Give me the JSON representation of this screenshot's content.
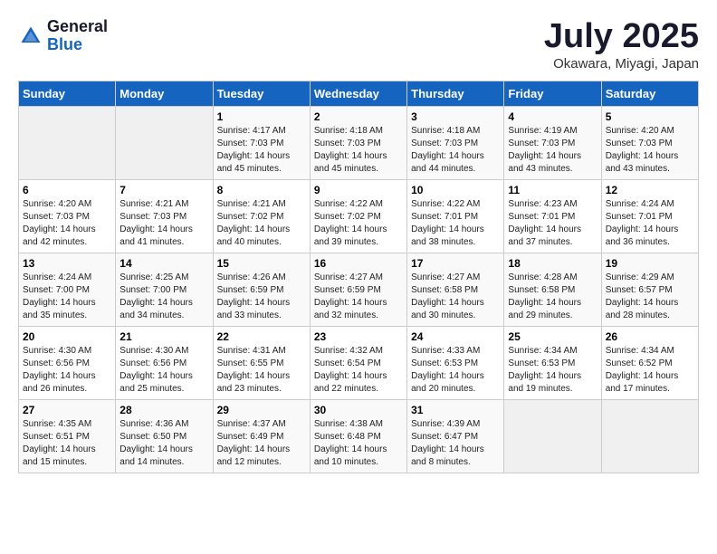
{
  "header": {
    "logo_general": "General",
    "logo_blue": "Blue",
    "month_title": "July 2025",
    "location": "Okawara, Miyagi, Japan"
  },
  "days_of_week": [
    "Sunday",
    "Monday",
    "Tuesday",
    "Wednesday",
    "Thursday",
    "Friday",
    "Saturday"
  ],
  "weeks": [
    [
      {
        "day": "",
        "info": ""
      },
      {
        "day": "",
        "info": ""
      },
      {
        "day": "1",
        "info": "Sunrise: 4:17 AM\nSunset: 7:03 PM\nDaylight: 14 hours and 45 minutes."
      },
      {
        "day": "2",
        "info": "Sunrise: 4:18 AM\nSunset: 7:03 PM\nDaylight: 14 hours and 45 minutes."
      },
      {
        "day": "3",
        "info": "Sunrise: 4:18 AM\nSunset: 7:03 PM\nDaylight: 14 hours and 44 minutes."
      },
      {
        "day": "4",
        "info": "Sunrise: 4:19 AM\nSunset: 7:03 PM\nDaylight: 14 hours and 43 minutes."
      },
      {
        "day": "5",
        "info": "Sunrise: 4:20 AM\nSunset: 7:03 PM\nDaylight: 14 hours and 43 minutes."
      }
    ],
    [
      {
        "day": "6",
        "info": "Sunrise: 4:20 AM\nSunset: 7:03 PM\nDaylight: 14 hours and 42 minutes."
      },
      {
        "day": "7",
        "info": "Sunrise: 4:21 AM\nSunset: 7:03 PM\nDaylight: 14 hours and 41 minutes."
      },
      {
        "day": "8",
        "info": "Sunrise: 4:21 AM\nSunset: 7:02 PM\nDaylight: 14 hours and 40 minutes."
      },
      {
        "day": "9",
        "info": "Sunrise: 4:22 AM\nSunset: 7:02 PM\nDaylight: 14 hours and 39 minutes."
      },
      {
        "day": "10",
        "info": "Sunrise: 4:22 AM\nSunset: 7:01 PM\nDaylight: 14 hours and 38 minutes."
      },
      {
        "day": "11",
        "info": "Sunrise: 4:23 AM\nSunset: 7:01 PM\nDaylight: 14 hours and 37 minutes."
      },
      {
        "day": "12",
        "info": "Sunrise: 4:24 AM\nSunset: 7:01 PM\nDaylight: 14 hours and 36 minutes."
      }
    ],
    [
      {
        "day": "13",
        "info": "Sunrise: 4:24 AM\nSunset: 7:00 PM\nDaylight: 14 hours and 35 minutes."
      },
      {
        "day": "14",
        "info": "Sunrise: 4:25 AM\nSunset: 7:00 PM\nDaylight: 14 hours and 34 minutes."
      },
      {
        "day": "15",
        "info": "Sunrise: 4:26 AM\nSunset: 6:59 PM\nDaylight: 14 hours and 33 minutes."
      },
      {
        "day": "16",
        "info": "Sunrise: 4:27 AM\nSunset: 6:59 PM\nDaylight: 14 hours and 32 minutes."
      },
      {
        "day": "17",
        "info": "Sunrise: 4:27 AM\nSunset: 6:58 PM\nDaylight: 14 hours and 30 minutes."
      },
      {
        "day": "18",
        "info": "Sunrise: 4:28 AM\nSunset: 6:58 PM\nDaylight: 14 hours and 29 minutes."
      },
      {
        "day": "19",
        "info": "Sunrise: 4:29 AM\nSunset: 6:57 PM\nDaylight: 14 hours and 28 minutes."
      }
    ],
    [
      {
        "day": "20",
        "info": "Sunrise: 4:30 AM\nSunset: 6:56 PM\nDaylight: 14 hours and 26 minutes."
      },
      {
        "day": "21",
        "info": "Sunrise: 4:30 AM\nSunset: 6:56 PM\nDaylight: 14 hours and 25 minutes."
      },
      {
        "day": "22",
        "info": "Sunrise: 4:31 AM\nSunset: 6:55 PM\nDaylight: 14 hours and 23 minutes."
      },
      {
        "day": "23",
        "info": "Sunrise: 4:32 AM\nSunset: 6:54 PM\nDaylight: 14 hours and 22 minutes."
      },
      {
        "day": "24",
        "info": "Sunrise: 4:33 AM\nSunset: 6:53 PM\nDaylight: 14 hours and 20 minutes."
      },
      {
        "day": "25",
        "info": "Sunrise: 4:34 AM\nSunset: 6:53 PM\nDaylight: 14 hours and 19 minutes."
      },
      {
        "day": "26",
        "info": "Sunrise: 4:34 AM\nSunset: 6:52 PM\nDaylight: 14 hours and 17 minutes."
      }
    ],
    [
      {
        "day": "27",
        "info": "Sunrise: 4:35 AM\nSunset: 6:51 PM\nDaylight: 14 hours and 15 minutes."
      },
      {
        "day": "28",
        "info": "Sunrise: 4:36 AM\nSunset: 6:50 PM\nDaylight: 14 hours and 14 minutes."
      },
      {
        "day": "29",
        "info": "Sunrise: 4:37 AM\nSunset: 6:49 PM\nDaylight: 14 hours and 12 minutes."
      },
      {
        "day": "30",
        "info": "Sunrise: 4:38 AM\nSunset: 6:48 PM\nDaylight: 14 hours and 10 minutes."
      },
      {
        "day": "31",
        "info": "Sunrise: 4:39 AM\nSunset: 6:47 PM\nDaylight: 14 hours and 8 minutes."
      },
      {
        "day": "",
        "info": ""
      },
      {
        "day": "",
        "info": ""
      }
    ]
  ]
}
